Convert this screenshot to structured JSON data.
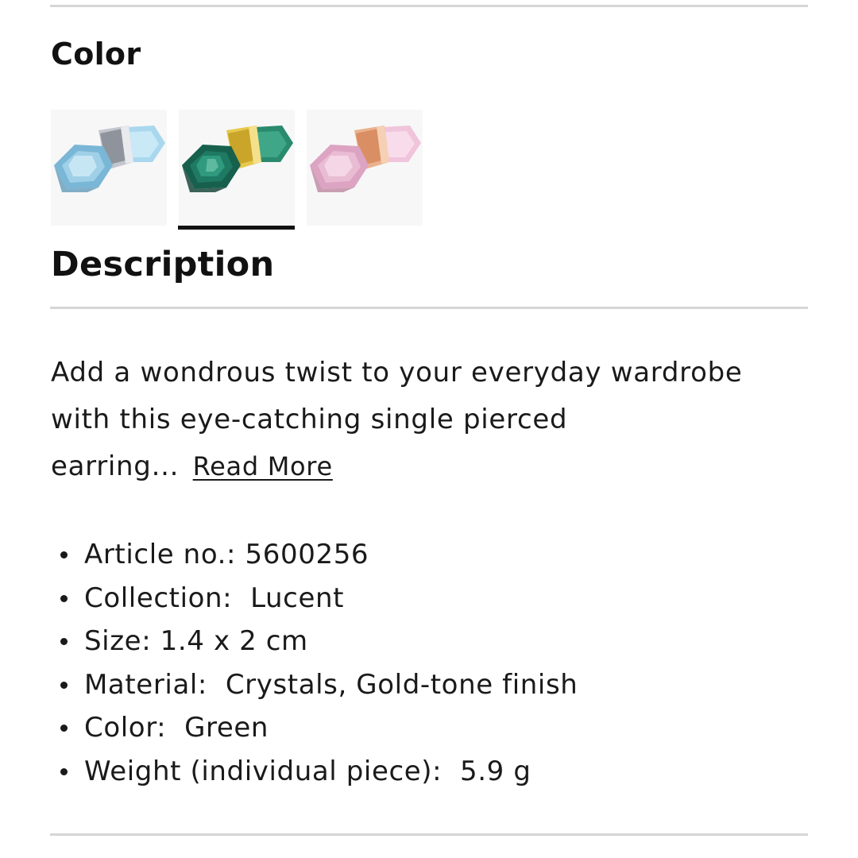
{
  "color_section": {
    "heading": "Color",
    "swatches": [
      {
        "name": "blue",
        "crystal_color": "#8fc6e2",
        "metal_color": "#b9bcc2",
        "selected": false
      },
      {
        "name": "green",
        "crystal_color": "#1e6f5c",
        "metal_color": "#e2c448",
        "selected": true
      },
      {
        "name": "pink",
        "crystal_color": "#e7b3cf",
        "metal_color": "#e8ab82",
        "selected": false
      }
    ]
  },
  "description": {
    "heading": "Description",
    "line1": "Add a wondrous twist to your everyday wardrobe",
    "line2": "with this eye-catching single pierced",
    "line3": "earring...",
    "read_more": "Read More"
  },
  "specs": [
    {
      "label": "Article no.:",
      "value": "5600256"
    },
    {
      "label": "Collection:",
      "value": "Lucent"
    },
    {
      "label": "Size:",
      "value": "1.4 x 2 cm"
    },
    {
      "label": "Material:",
      "value": "Crystals, Gold-tone finish"
    },
    {
      "label": "Color:",
      "value": "Green"
    },
    {
      "label": "Weight (individual piece):",
      "value": "5.9 g"
    }
  ],
  "colors": {
    "text": "#111111",
    "divider": "#d6d6d6",
    "highlight": "#ffb3df"
  }
}
